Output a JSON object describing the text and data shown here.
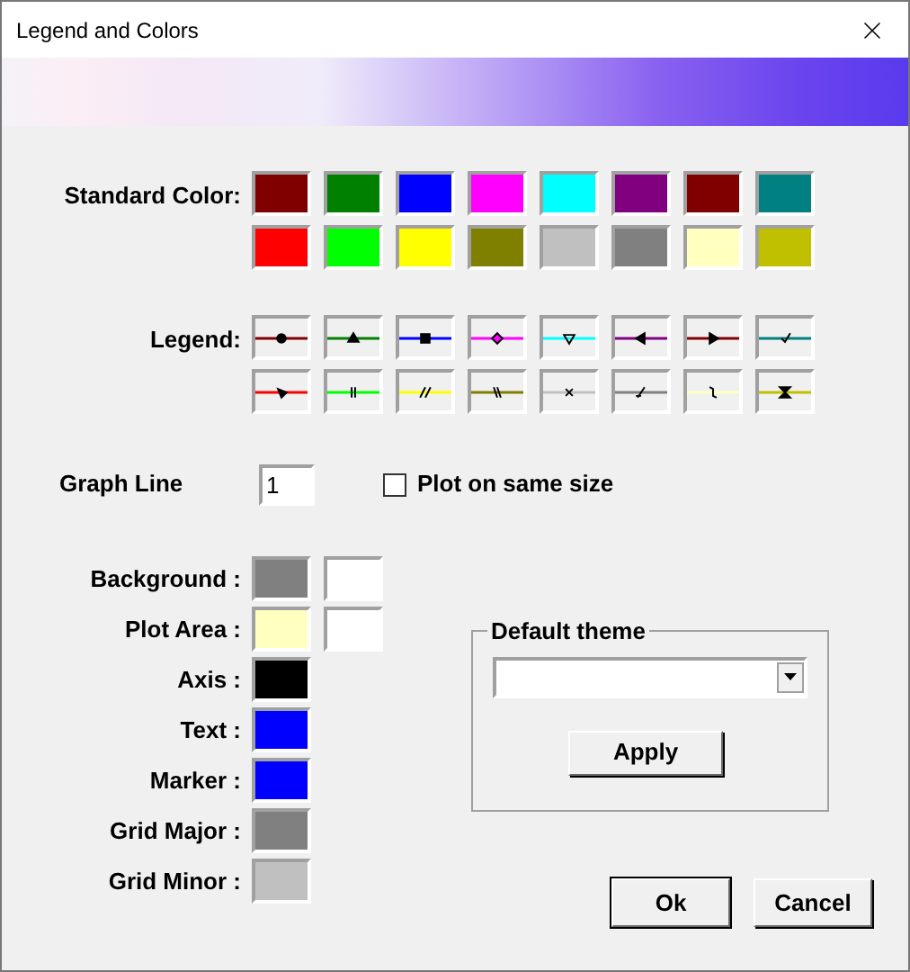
{
  "window": {
    "title": "Legend and Colors"
  },
  "standard_colors": {
    "label": "Standard Color:",
    "swatches": [
      {
        "color": "#800000"
      },
      {
        "color": "#008000"
      },
      {
        "color": "#0000ff"
      },
      {
        "color": "#ff00ff"
      },
      {
        "color": "#00ffff"
      },
      {
        "color": "#800080"
      },
      {
        "color": "#800000"
      },
      {
        "color": "#008080"
      },
      {
        "color": "#ff0000"
      },
      {
        "color": "#00ff00"
      },
      {
        "color": "#ffff00"
      },
      {
        "color": "#808000"
      },
      {
        "color": "#c0c0c0"
      },
      {
        "color": "#808080"
      },
      {
        "color": "#ffffc0"
      },
      {
        "color": "#c0c000"
      }
    ]
  },
  "legend": {
    "label": "Legend:",
    "items": [
      {
        "kind": "circle",
        "color": "#800000"
      },
      {
        "kind": "triangle",
        "color": "#008000"
      },
      {
        "kind": "square",
        "color": "#0000ff"
      },
      {
        "kind": "diamond",
        "color": "#ff00ff"
      },
      {
        "kind": "triangle-down",
        "color": "#00ffff"
      },
      {
        "kind": "triangle-left",
        "color": "#800080"
      },
      {
        "kind": "triangle-right",
        "color": "#800000"
      },
      {
        "kind": "check",
        "color": "#008080"
      },
      {
        "kind": "arrow-down",
        "color": "#ff0000"
      },
      {
        "kind": "double-bar",
        "color": "#00ff00"
      },
      {
        "kind": "double-slash",
        "color": "#ffff00"
      },
      {
        "kind": "double-backslash",
        "color": "#808000"
      },
      {
        "kind": "cross",
        "color": "#c0c0c0"
      },
      {
        "kind": "slash",
        "color": "#808080"
      },
      {
        "kind": "curve",
        "color": "#ffffc0"
      },
      {
        "kind": "hourglass",
        "color": "#c0c000"
      }
    ]
  },
  "graph_line": {
    "label": "Graph Line",
    "value": "1"
  },
  "plot_same_size": {
    "label": "Plot on same size",
    "checked": false
  },
  "color_settings": [
    {
      "label": "Background :",
      "swatches": [
        {
          "color": "#808080"
        },
        {
          "color": "#ffffff"
        }
      ]
    },
    {
      "label": "Plot Area :",
      "swatches": [
        {
          "color": "#ffffc0"
        },
        {
          "color": "#ffffff"
        }
      ]
    },
    {
      "label": "Axis :",
      "swatches": [
        {
          "color": "#000000"
        }
      ]
    },
    {
      "label": "Text :",
      "swatches": [
        {
          "color": "#0000ff"
        }
      ]
    },
    {
      "label": "Marker :",
      "swatches": [
        {
          "color": "#0000ff"
        }
      ]
    },
    {
      "label": "Grid Major :",
      "swatches": [
        {
          "color": "#808080"
        }
      ]
    },
    {
      "label": "Grid Minor :",
      "swatches": [
        {
          "color": "#c0c0c0"
        }
      ]
    }
  ],
  "default_theme": {
    "title": "Default theme",
    "apply": "Apply"
  },
  "buttons": [
    {
      "label": "Ok",
      "default": true
    },
    {
      "label": "Cancel",
      "default": false
    }
  ]
}
